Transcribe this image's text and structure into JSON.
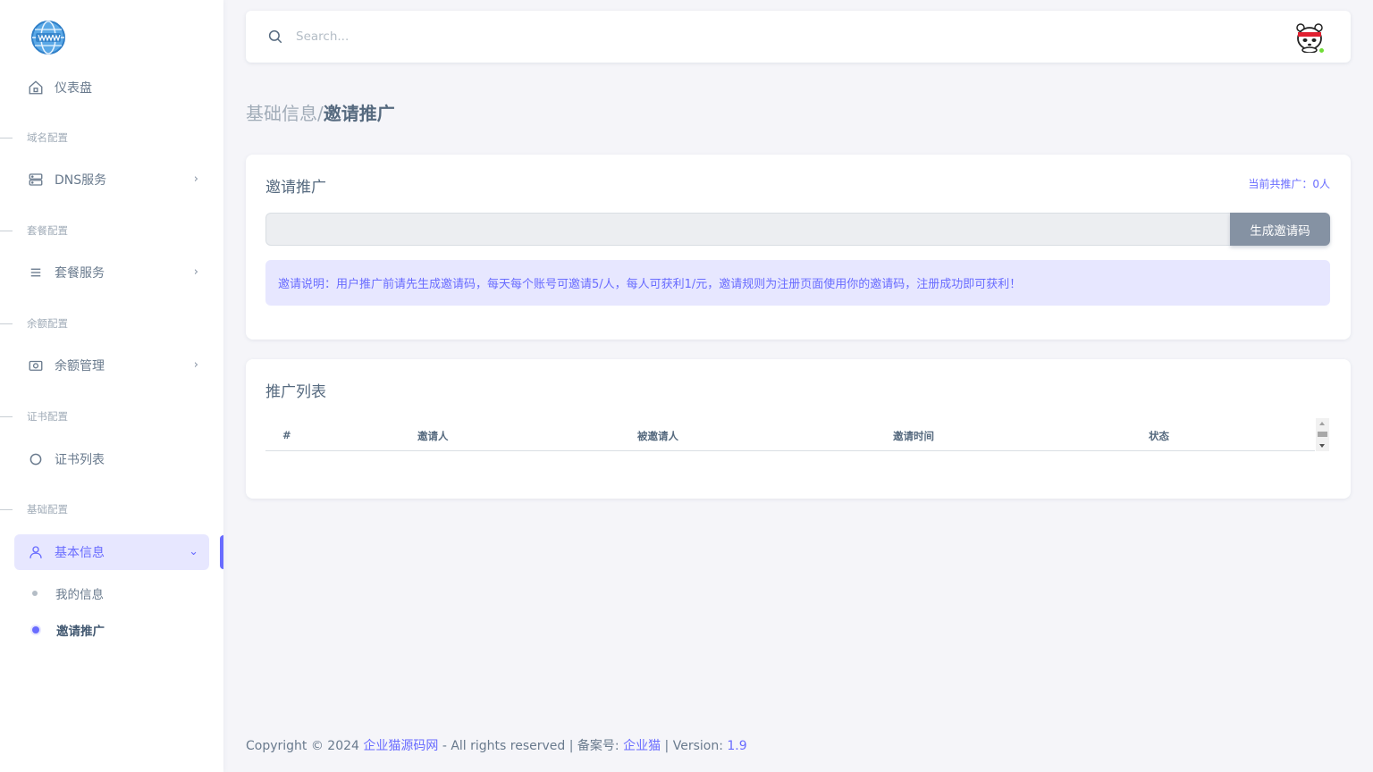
{
  "sidebar": {
    "items": {
      "dashboard": "仪表盘",
      "dns": "DNS服务",
      "package": "套餐服务",
      "balance": "余额管理",
      "cert": "证书列表",
      "basic": "基本信息"
    },
    "sections": {
      "domain": "域名配置",
      "package": "套餐配置",
      "balance": "余额配置",
      "cert": "证书配置",
      "basic": "基础配置"
    },
    "sub_items": {
      "my_info": "我的信息",
      "invite": "邀请推广"
    }
  },
  "navbar": {
    "search_placeholder": "Search..."
  },
  "breadcrumb": {
    "parent": "基础信息/",
    "current": "邀请推广"
  },
  "invite_card": {
    "title": "邀请推广",
    "count_label": "当前共推广：",
    "count_value": "0人",
    "input_value": "",
    "button_label": "生成邀请码",
    "notice": "邀请说明：用户推广前请先生成邀请码，每天每个账号可邀请5/人，每人可获利1/元，邀请规则为注册页面使用你的邀请码，注册成功即可获利！"
  },
  "list_card": {
    "title": "推广列表",
    "columns": [
      "#",
      "邀请人",
      "被邀请人",
      "邀请时间",
      "状态"
    ]
  },
  "footer": {
    "copyright": "Copyright © 2024 ",
    "company": "企业猫源码网",
    "rights": " - All rights reserved | 备案号: ",
    "icp": "企业猫",
    "version_label": " | Version: ",
    "version": "1.9"
  },
  "colors": {
    "primary": "#696cff",
    "secondary": "#8592a3",
    "background": "#f5f5f9"
  }
}
